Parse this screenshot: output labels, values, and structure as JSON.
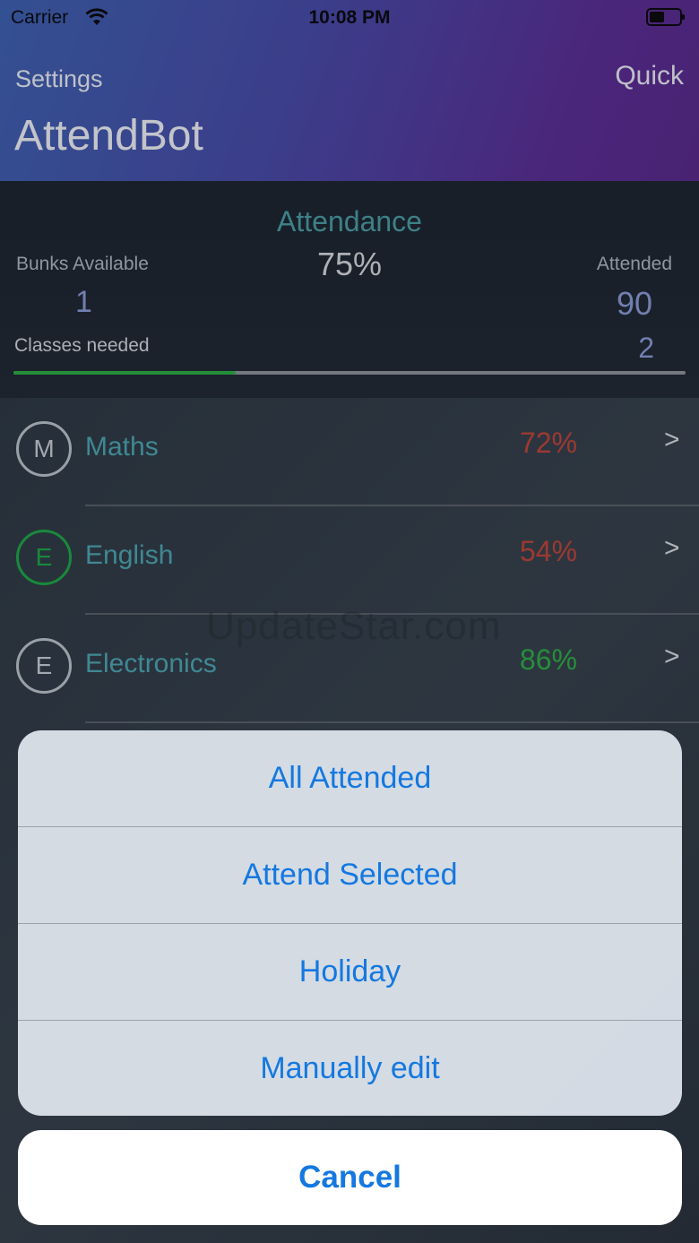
{
  "status_bar": {
    "carrier": "Carrier",
    "time": "10:08 PM"
  },
  "nav": {
    "left": "Settings",
    "right": "Quick"
  },
  "app_title": "AttendBot",
  "summary": {
    "attendance_label": "Attendance",
    "attendance_value": "75%",
    "bunks_label": "Bunks Available",
    "bunks_value": "1",
    "attended_label": "Attended",
    "attended_value": "90",
    "classes_label": "Classes needed",
    "classes_value": "2",
    "progress_fraction": 0.33
  },
  "subjects": [
    {
      "initial": "M",
      "name": "Maths",
      "percent": "72%",
      "status": "low"
    },
    {
      "initial": "E",
      "name": "English",
      "percent": "54%",
      "status": "low"
    },
    {
      "initial": "E",
      "name": "Electronics",
      "percent": "86%",
      "status": "good"
    }
  ],
  "chevron": ">",
  "watermark": "UpdateStar.com",
  "colors": {
    "low": "#c0463c",
    "good": "#2fae48",
    "accent": "#1478e0",
    "progress": "#2fae48"
  },
  "action_sheet": {
    "options": [
      "All Attended",
      "Attend Selected",
      "Holiday",
      "Manually edit"
    ],
    "cancel": "Cancel"
  },
  "icons": {
    "wifi": "wifi-icon",
    "battery": "battery-icon",
    "chevron": "chevron-right-icon"
  }
}
